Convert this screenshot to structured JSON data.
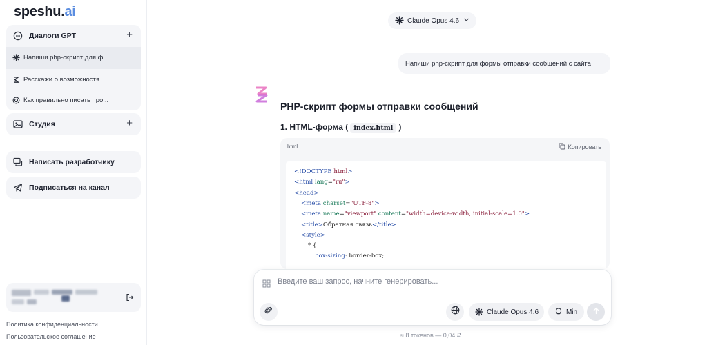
{
  "logo": {
    "main": "speshu.",
    "suffix": "ai"
  },
  "sidebar": {
    "dialogs": {
      "title": "Диалоги GPT",
      "items": [
        {
          "label": "Напиши php-скрипт для ф...",
          "icon": "claude-icon"
        },
        {
          "label": "Расскажи о возможностя...",
          "icon": "sonar-icon"
        },
        {
          "label": "Как правильно писать про...",
          "icon": "openai-icon"
        }
      ]
    },
    "studio": {
      "title": "Студия"
    },
    "write_dev": "Написать разработчику",
    "subscribe": "Подписаться на канал",
    "footer": {
      "privacy": "Политика конфиденциальности",
      "terms": "Пользовательское соглашение"
    }
  },
  "header": {
    "model": "Claude Opus 4.6"
  },
  "chat": {
    "user_message": "Напиши php-скрипт для формы отправки сообщений с сайта",
    "answer_title": "PHP-скрипт формы отправки сообщений",
    "section_prefix": "1. HTML-форма (",
    "section_code": "index.html",
    "section_suffix": ")",
    "code_lang": "html",
    "copy_label": "Копировать",
    "code_lines": [
      {
        "indent": 0,
        "parts": [
          [
            "tag",
            "<!DOCTYPE "
          ],
          [
            "str",
            "html"
          ],
          [
            "tag",
            ">"
          ]
        ]
      },
      {
        "indent": 0,
        "parts": [
          [
            "tag",
            "<html "
          ],
          [
            "attr",
            "lang"
          ],
          [
            "plain",
            "="
          ],
          [
            "str",
            "\"ru\""
          ],
          [
            "tag",
            ">"
          ]
        ]
      },
      {
        "indent": 0,
        "parts": [
          [
            "tag",
            "<head>"
          ]
        ]
      },
      {
        "indent": 1,
        "parts": [
          [
            "tag",
            "<meta "
          ],
          [
            "attr",
            "charset"
          ],
          [
            "plain",
            "="
          ],
          [
            "str",
            "\"UTF-8\""
          ],
          [
            "tag",
            ">"
          ]
        ]
      },
      {
        "indent": 1,
        "parts": [
          [
            "tag",
            "<meta "
          ],
          [
            "attr",
            "name"
          ],
          [
            "plain",
            "="
          ],
          [
            "str",
            "\"viewport\" "
          ],
          [
            "attr",
            "content"
          ],
          [
            "plain",
            "="
          ],
          [
            "str",
            "\"width=device-width, initial-scale=1.0\""
          ],
          [
            "tag",
            ">"
          ]
        ]
      },
      {
        "indent": 1,
        "parts": [
          [
            "tag",
            "<title>"
          ],
          [
            "plain",
            "Обратная связь"
          ],
          [
            "tag",
            "</title>"
          ]
        ]
      },
      {
        "indent": 1,
        "parts": [
          [
            "tag",
            "<style>"
          ]
        ]
      },
      {
        "indent": 2,
        "parts": [
          [
            "plain",
            "* {"
          ]
        ]
      },
      {
        "indent": 3,
        "parts": [
          [
            "prop",
            "box-sizing"
          ],
          [
            "plain",
            ": border-box;"
          ]
        ]
      }
    ]
  },
  "composer": {
    "placeholder": "Введите ваш запрос, начните генерировать...",
    "model_chip": "Claude Opus 4.6",
    "mode_chip": "Min"
  },
  "tokens": "≈ 8 токенов — 0,04 ₽",
  "colors": {
    "accent": "#5b8de0",
    "brand_logo": "#e86fbd"
  }
}
